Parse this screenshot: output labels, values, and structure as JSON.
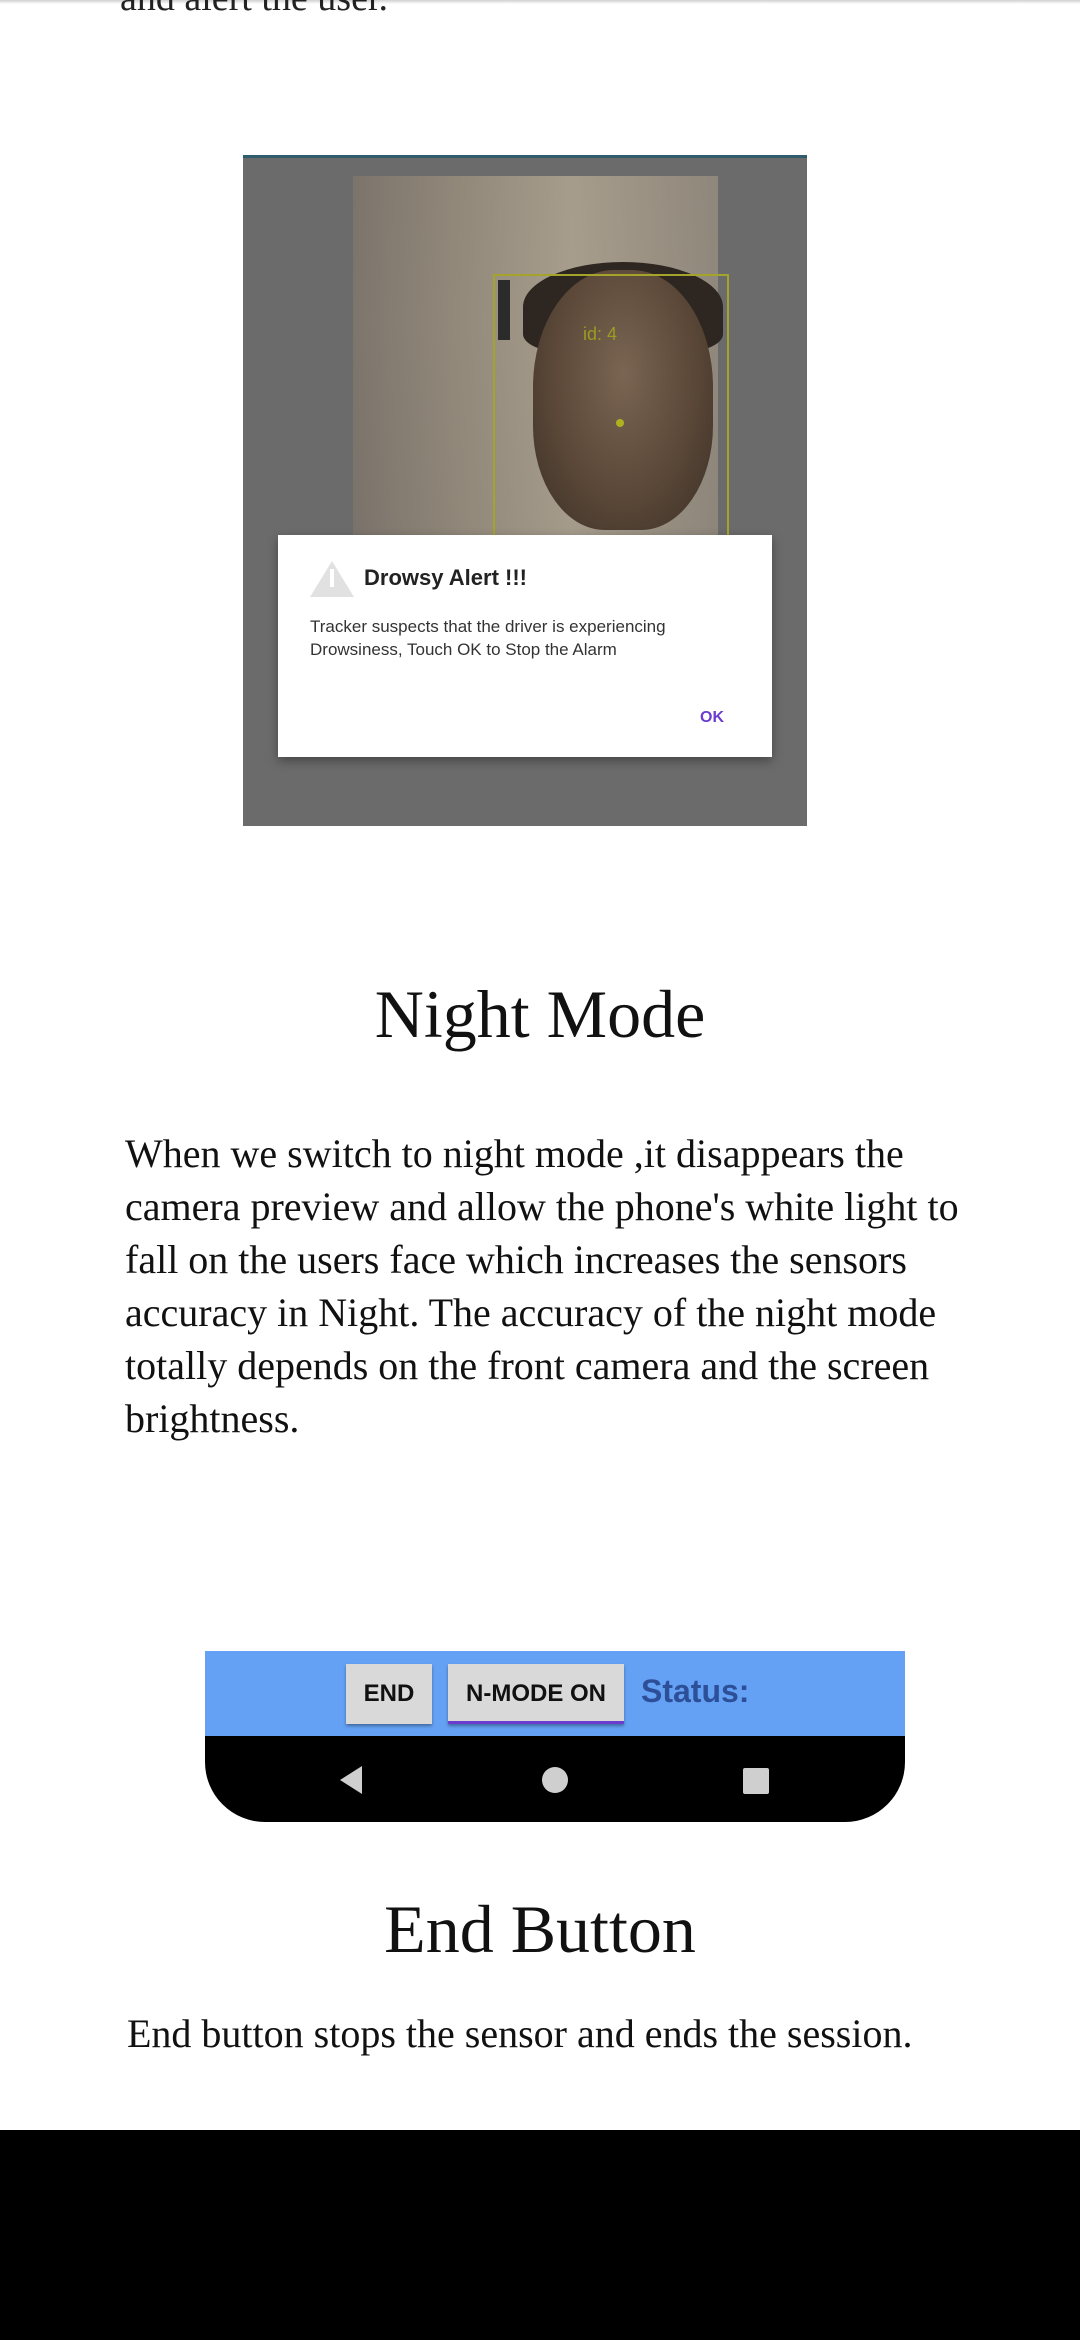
{
  "intro_tail": "and alert the user.",
  "alert_screenshot": {
    "camera_label": "id: 4",
    "dialog": {
      "icon": "warning-icon",
      "title": "Drowsy Alert !!!",
      "message": "Tracker suspects that the driver is experiencing Drowsiness, Touch OK to Stop the Alarm",
      "ok_label": "OK",
      "accent_color": "#6a3ccf"
    }
  },
  "night_mode": {
    "heading": "Night Mode",
    "body": "When we switch to night mode ,it disappears the camera preview and allow the phone's white light to fall on the users face which increases the sensors accuracy in Night. The accuracy of the night mode totally depends on the front camera and the screen brightness."
  },
  "control_bar": {
    "end_label": "END",
    "nmode_label": "N-MODE ON",
    "status_label": "Status:",
    "bar_color": "#64a1f4",
    "nav_icons": [
      "back-icon",
      "home-icon",
      "recents-icon"
    ]
  },
  "end_button": {
    "heading": "End Button",
    "body": "End button stops the sensor and ends the session."
  }
}
